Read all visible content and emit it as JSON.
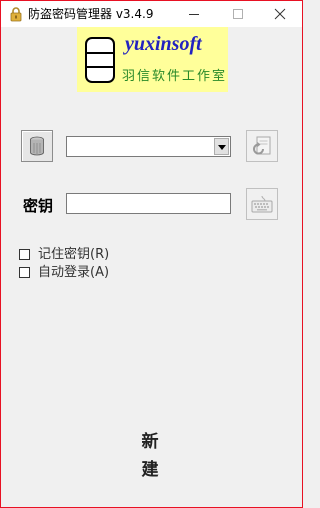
{
  "window": {
    "title": "防盗密码管理器 v3.4.9"
  },
  "logo": {
    "name": "yuxinsoft",
    "subtitle": "羽信软件工作室"
  },
  "database": {
    "selected": ""
  },
  "key": {
    "label": "密钥",
    "value": ""
  },
  "options": {
    "remember_key": {
      "label": "记住密钥(R)",
      "checked": false
    },
    "auto_login": {
      "label": "自动登录(A)",
      "checked": false
    }
  },
  "actions": {
    "new_label": "新 建"
  },
  "colors": {
    "logo_background": "#ffff9a",
    "logo_name": "#2222c0",
    "logo_subtitle": "#2a8a2a",
    "window_border": "#e81123"
  }
}
